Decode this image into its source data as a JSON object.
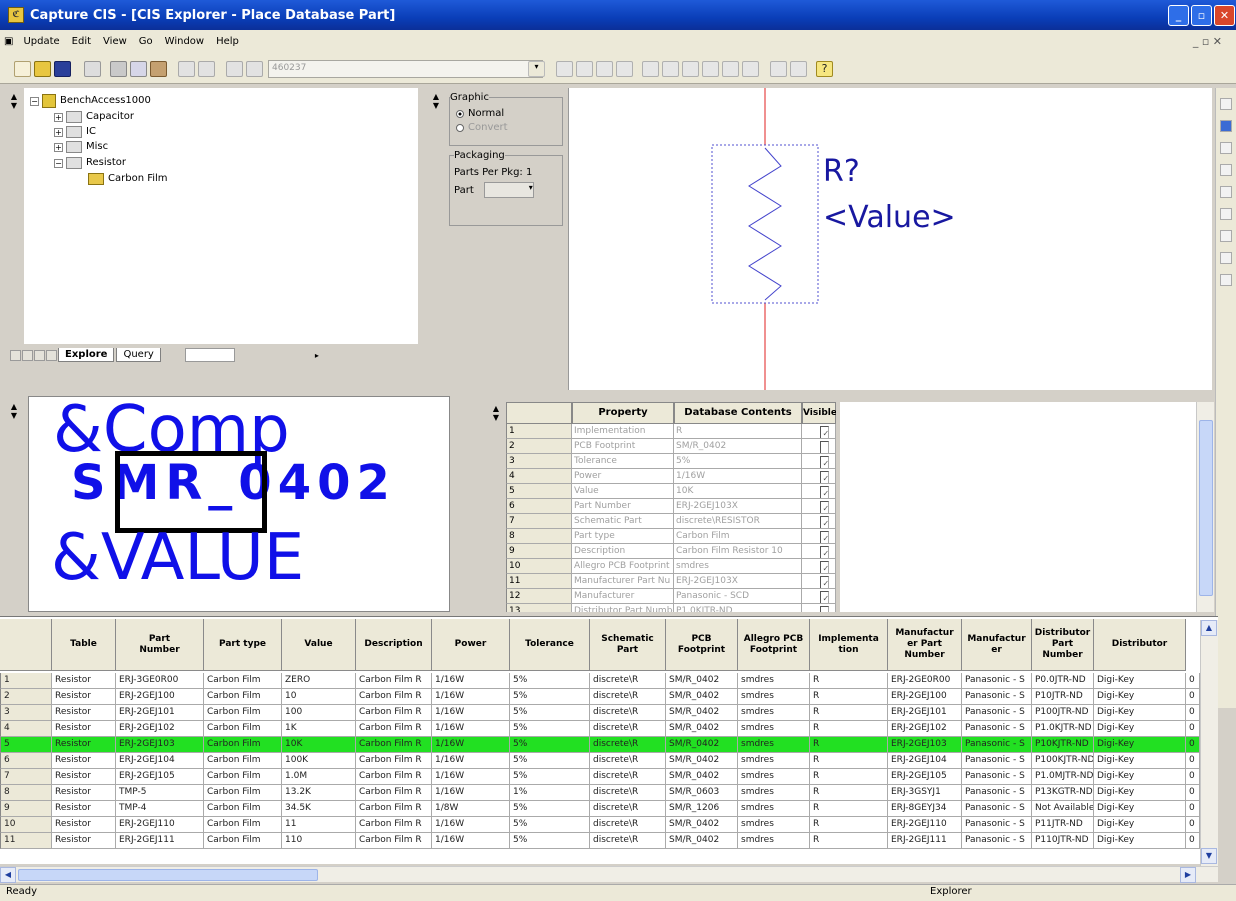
{
  "window": {
    "title": "Capture CIS - [CIS Explorer - Place Database Part]"
  },
  "menu": [
    "Update",
    "Edit",
    "View",
    "Go",
    "Window",
    "Help"
  ],
  "toolbar": {
    "combo_value": "460237"
  },
  "tree": {
    "root": "BenchAccess1000",
    "nodes": [
      "Capacitor",
      "IC",
      "Misc",
      "Resistor"
    ],
    "leaf": "Carbon Film"
  },
  "explorer_tabs": [
    "Explore",
    "Query"
  ],
  "graphic": {
    "group_label": "Graphic",
    "normal": "Normal",
    "convert": "Convert",
    "packaging_label": "Packaging",
    "parts_per_pkg": "Parts Per Pkg: 1",
    "part_label": "Part"
  },
  "schematic": {
    "refdes": "R?",
    "value": "<Value>"
  },
  "footprint": {
    "line1": "&Comp",
    "line2": "SMR_0402",
    "line3": "&VALUE"
  },
  "properties": {
    "headers": [
      "Property",
      "Database Contents",
      "Visible"
    ],
    "rows": [
      {
        "n": "1",
        "p": "Implementation",
        "v": "R",
        "vis": true
      },
      {
        "n": "2",
        "p": "PCB Footprint",
        "v": "SM/R_0402",
        "vis": false
      },
      {
        "n": "3",
        "p": "Tolerance",
        "v": "5%",
        "vis": true
      },
      {
        "n": "4",
        "p": "Power",
        "v": "1/16W",
        "vis": true
      },
      {
        "n": "5",
        "p": "Value",
        "v": "10K",
        "vis": true
      },
      {
        "n": "6",
        "p": "Part Number",
        "v": "ERJ-2GEJ103X",
        "vis": true
      },
      {
        "n": "7",
        "p": "Schematic Part",
        "v": "discrete\\RESISTOR",
        "vis": true
      },
      {
        "n": "8",
        "p": "Part type",
        "v": "Carbon Film",
        "vis": true
      },
      {
        "n": "9",
        "p": "Description",
        "v": "Carbon Film Resistor 10",
        "vis": true
      },
      {
        "n": "10",
        "p": "Allegro PCB Footprint",
        "v": "smdres",
        "vis": true
      },
      {
        "n": "11",
        "p": "Manufacturer Part Nu",
        "v": "ERJ-2GEJ103X",
        "vis": true
      },
      {
        "n": "12",
        "p": "Manufacturer",
        "v": "Panasonic - SCD",
        "vis": true
      },
      {
        "n": "13",
        "p": "Distributor Part Numbe",
        "v": "P1.0KJTR-ND",
        "vis": false
      }
    ]
  },
  "grid": {
    "headers": [
      "Table",
      "Part Number",
      "Part type",
      "Value",
      "Description",
      "Power",
      "Tolerance",
      "Schematic Part",
      "PCB Footprint",
      "Allegro PCB Footprint",
      "Implementation",
      "Manufacturer Part Number",
      "Manufacturer",
      "Distributor Part Number",
      "Distributor"
    ],
    "header_display": [
      "Table",
      "Part\nNumber",
      "Part type",
      "Value",
      "Description",
      "Power",
      "Tolerance",
      "Schematic\nPart",
      "PCB\nFootprint",
      "Allegro PCB\nFootprint",
      "Implementa\ntion",
      "Manufactur\ner Part\nNumber",
      "Manufactur\ner",
      "Distributor\nPart\nNumber",
      "Distributor"
    ],
    "rows": [
      [
        "1",
        "Resistor",
        "ERJ-3GE0R00",
        "Carbon Film",
        "ZERO",
        "Carbon Film R",
        "1/16W",
        "5%",
        "discrete\\R",
        "SM/R_0402",
        "smdres",
        "R",
        "ERJ-2GE0R00",
        "Panasonic - S",
        "P0.0JTR-ND",
        "Digi-Key",
        "0"
      ],
      [
        "2",
        "Resistor",
        "ERJ-2GEJ100",
        "Carbon Film",
        "10",
        "Carbon Film R",
        "1/16W",
        "5%",
        "discrete\\R",
        "SM/R_0402",
        "smdres",
        "R",
        "ERJ-2GEJ100",
        "Panasonic - S",
        "P10JTR-ND",
        "Digi-Key",
        "0"
      ],
      [
        "3",
        "Resistor",
        "ERJ-2GEJ101",
        "Carbon Film",
        "100",
        "Carbon Film R",
        "1/16W",
        "5%",
        "discrete\\R",
        "SM/R_0402",
        "smdres",
        "R",
        "ERJ-2GEJ101",
        "Panasonic - S",
        "P100JTR-ND",
        "Digi-Key",
        "0"
      ],
      [
        "4",
        "Resistor",
        "ERJ-2GEJ102",
        "Carbon Film",
        "1K",
        "Carbon Film R",
        "1/16W",
        "5%",
        "discrete\\R",
        "SM/R_0402",
        "smdres",
        "R",
        "ERJ-2GEJ102",
        "Panasonic - S",
        "P1.0KJTR-ND",
        "Digi-Key",
        "0"
      ],
      [
        "5",
        "Resistor",
        "ERJ-2GEJ103",
        "Carbon Film",
        "10K",
        "Carbon Film R",
        "1/16W",
        "5%",
        "discrete\\R",
        "SM/R_0402",
        "smdres",
        "R",
        "ERJ-2GEJ103",
        "Panasonic - S",
        "P10KJTR-ND",
        "Digi-Key",
        "0"
      ],
      [
        "6",
        "Resistor",
        "ERJ-2GEJ104",
        "Carbon Film",
        "100K",
        "Carbon Film R",
        "1/16W",
        "5%",
        "discrete\\R",
        "SM/R_0402",
        "smdres",
        "R",
        "ERJ-2GEJ104",
        "Panasonic - S",
        "P100KJTR-ND",
        "Digi-Key",
        "0"
      ],
      [
        "7",
        "Resistor",
        "ERJ-2GEJ105",
        "Carbon Film",
        "1.0M",
        "Carbon Film R",
        "1/16W",
        "5%",
        "discrete\\R",
        "SM/R_0402",
        "smdres",
        "R",
        "ERJ-2GEJ105",
        "Panasonic - S",
        "P1.0MJTR-ND",
        "Digi-Key",
        "0"
      ],
      [
        "8",
        "Resistor",
        "TMP-5",
        "Carbon Film",
        "13.2K",
        "Carbon Film R",
        "1/16W",
        "1%",
        "discrete\\R",
        "SM/R_0603",
        "smdres",
        "R",
        "ERJ-3GSYJ1",
        "Panasonic - S",
        "P13KGTR-ND",
        "Digi-Key",
        "0"
      ],
      [
        "9",
        "Resistor",
        "TMP-4",
        "Carbon Film",
        "34.5K",
        "Carbon Film R",
        "1/8W",
        "5%",
        "discrete\\R",
        "SM/R_1206",
        "smdres",
        "R",
        "ERJ-8GEYJ34",
        "Panasonic - S",
        "Not Available",
        "Digi-Key",
        "0"
      ],
      [
        "10",
        "Resistor",
        "ERJ-2GEJ110",
        "Carbon Film",
        "11",
        "Carbon Film R",
        "1/16W",
        "5%",
        "discrete\\R",
        "SM/R_0402",
        "smdres",
        "R",
        "ERJ-2GEJ110",
        "Panasonic - S",
        "P11JTR-ND",
        "Digi-Key",
        "0"
      ],
      [
        "11",
        "Resistor",
        "ERJ-2GEJ111",
        "Carbon Film",
        "110",
        "Carbon Film R",
        "1/16W",
        "5%",
        "discrete\\R",
        "SM/R_0402",
        "smdres",
        "R",
        "ERJ-2GEJ111",
        "Panasonic - S",
        "P110JTR-ND",
        "Digi-Key",
        "0"
      ]
    ],
    "selected_row": 4
  },
  "status": {
    "left": "Ready",
    "right": "Explorer"
  },
  "colors": {
    "title_blue": "#0a3eb8",
    "footprint_blue": "#1010e8",
    "schematic_red": "#e02020",
    "selection_green": "#22e022"
  }
}
